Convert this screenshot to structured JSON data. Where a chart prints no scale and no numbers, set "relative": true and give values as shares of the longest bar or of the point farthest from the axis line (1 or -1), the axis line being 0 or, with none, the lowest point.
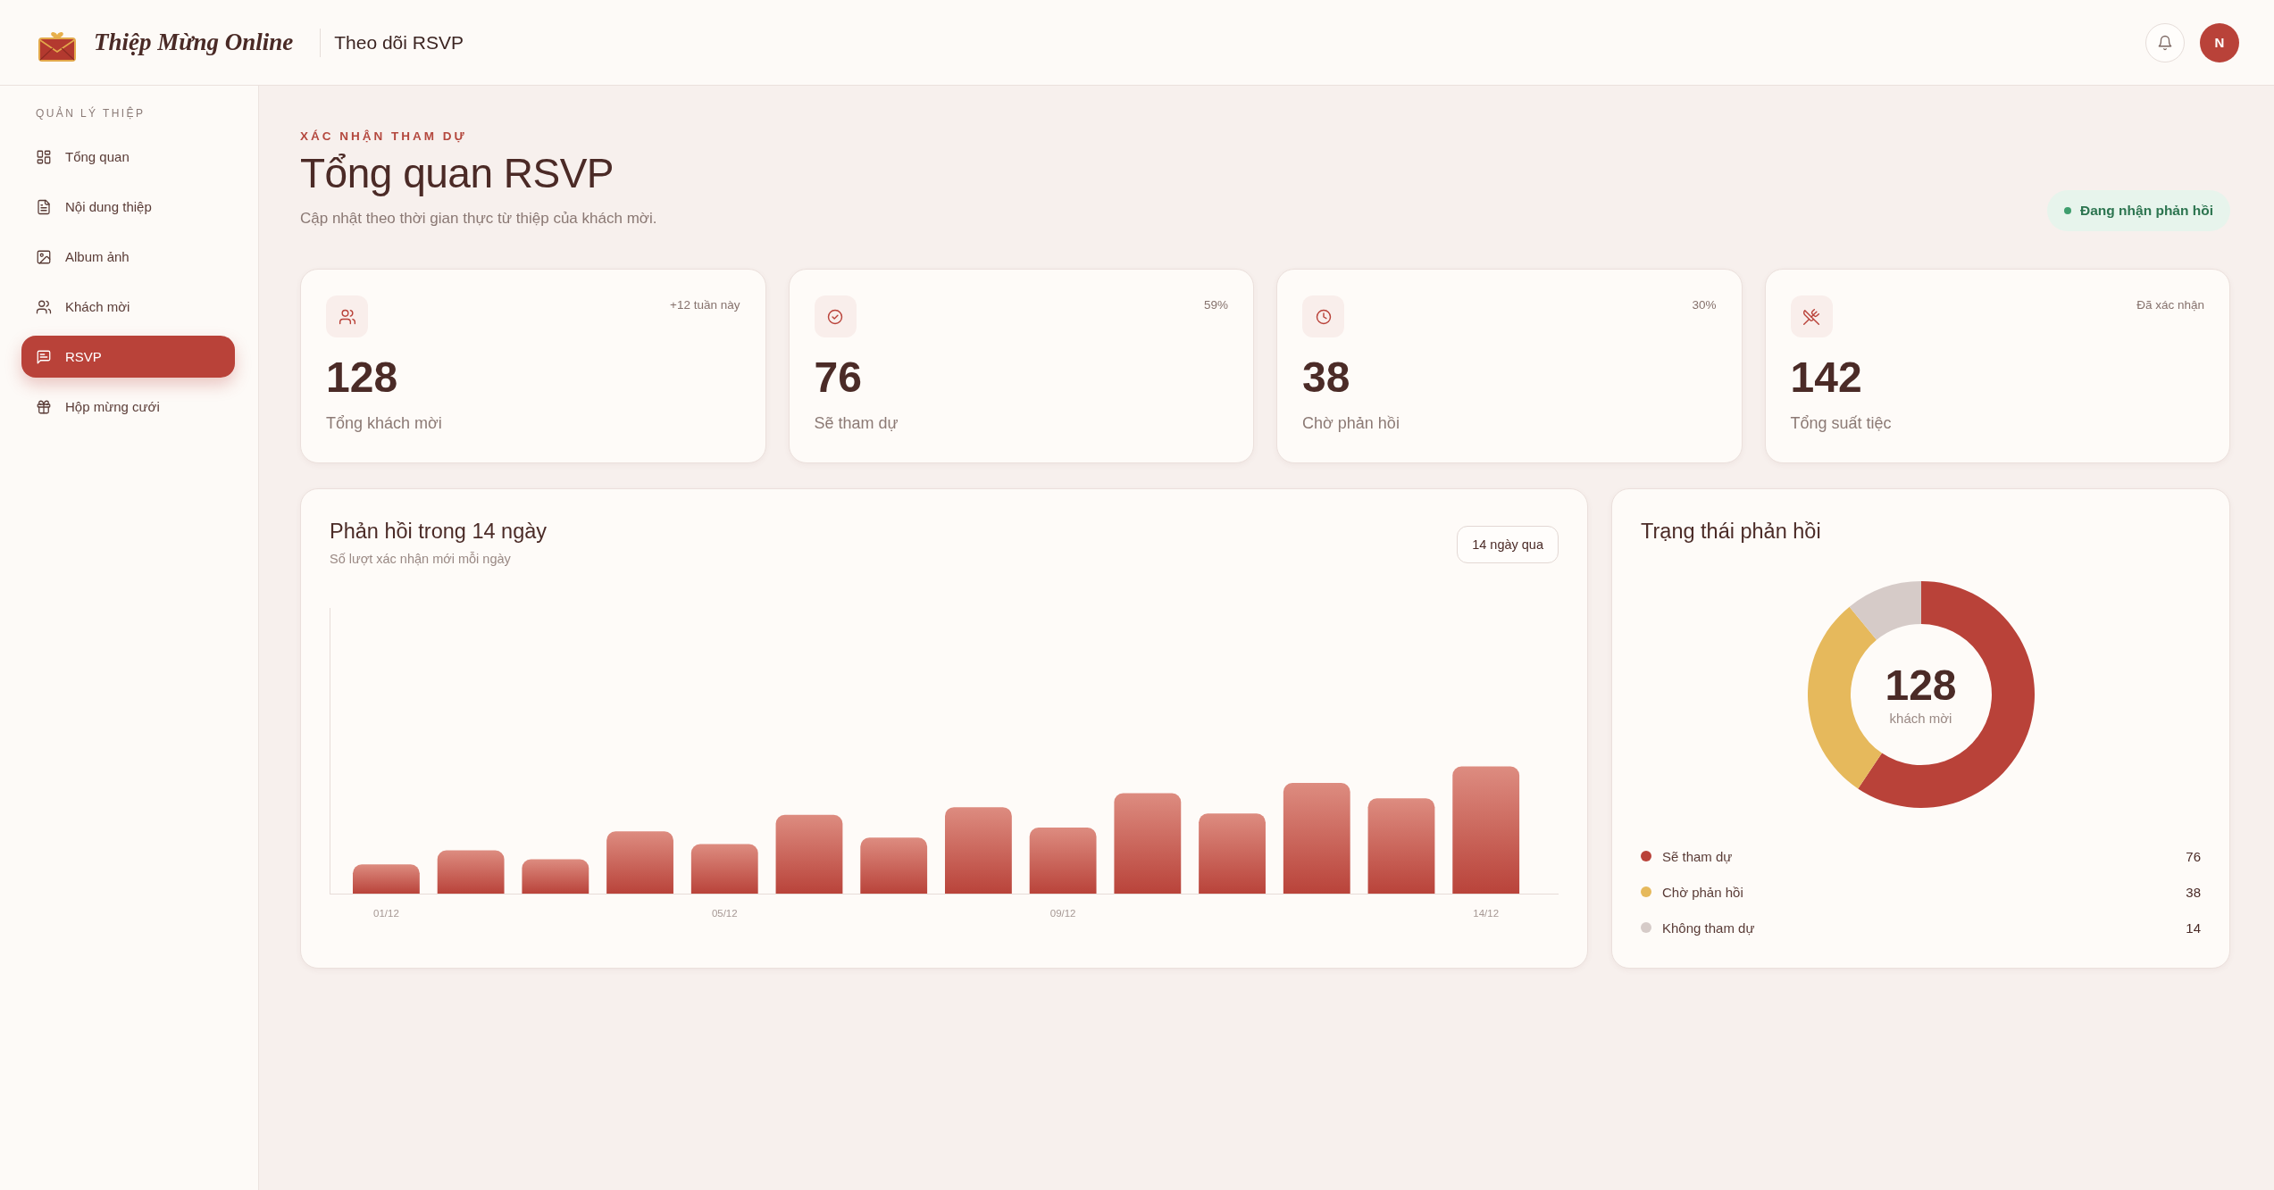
{
  "header": {
    "brand": "Thiệp Mừng Online",
    "title": "Theo dõi RSVP",
    "avatar": "N"
  },
  "sidebar": {
    "section": "QUẢN LÝ THIỆP",
    "items": [
      {
        "label": "Tổng quan",
        "selected": false
      },
      {
        "label": "Nội dung thiệp",
        "selected": false
      },
      {
        "label": "Album ảnh",
        "selected": false
      },
      {
        "label": "Khách mời",
        "selected": false
      },
      {
        "label": "RSVP",
        "selected": true
      },
      {
        "label": "Hộp mừng cưới",
        "selected": false
      }
    ]
  },
  "page": {
    "eyebrow": "XÁC NHẬN THAM DỰ",
    "title": "Tổng quan RSVP",
    "subtitle": "Cập nhật theo thời gian thực từ thiệp của khách mời.",
    "status": "Đang nhận phản hồi"
  },
  "stats": [
    {
      "value": "128",
      "label": "Tổng khách mời",
      "note": "+12 tuần này"
    },
    {
      "value": "76",
      "label": "Sẽ tham dự",
      "note": "59%"
    },
    {
      "value": "38",
      "label": "Chờ phản hồi",
      "note": "30%"
    },
    {
      "value": "142",
      "label": "Tổng suất tiệc",
      "note": "Đã xác nhận"
    }
  ],
  "responses_card": {
    "title": "Phản hồi trong 14 ngày",
    "subtitle": "Số lượt xác nhận mới mỗi ngày",
    "range_button": "14 ngày qua",
    "chart_data": {
      "type": "bar",
      "relative": true,
      "categories": [
        "01/12",
        null,
        null,
        null,
        "05/12",
        null,
        null,
        null,
        "09/12",
        null,
        null,
        null,
        null,
        "14/12"
      ],
      "values": [
        0.23,
        0.34,
        0.27,
        0.49,
        0.39,
        0.62,
        0.44,
        0.68,
        0.52,
        0.79,
        0.63,
        0.87,
        0.75,
        1
      ]
    }
  },
  "status_card": {
    "title": "Trạng thái phản hồi",
    "center_value": "128",
    "center_label": "khách mời",
    "chart_data": {
      "type": "donut",
      "categories": [
        "Sẽ tham dự",
        "Chờ phản hồi",
        "Không tham dự"
      ],
      "values": [
        59.4,
        29.7,
        10.9
      ]
    },
    "legend": [
      {
        "value": "76",
        "color": "#b94239"
      },
      {
        "value": "38",
        "color": "#e6b95c"
      },
      {
        "value": "14",
        "color": "#d6cbc8"
      }
    ]
  }
}
